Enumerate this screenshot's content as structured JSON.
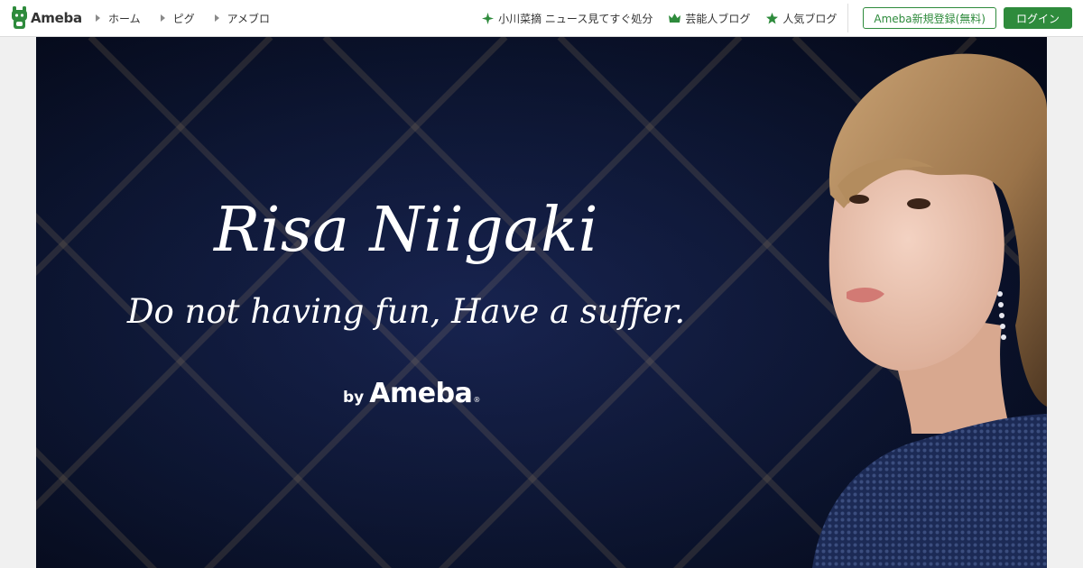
{
  "header": {
    "logo_text": "Ameba",
    "nav_left": [
      {
        "label": "ホーム"
      },
      {
        "label": "ピグ"
      },
      {
        "label": "アメブロ"
      }
    ],
    "nav_right": [
      {
        "label": "小川菜摘 ニュース見てすぐ処分",
        "icon": "sparkle-icon"
      },
      {
        "label": "芸能人ブログ",
        "icon": "crown-icon"
      },
      {
        "label": "人気ブログ",
        "icon": "star-icon"
      }
    ],
    "register_label": "Ameba新規登録(無料)",
    "login_label": "ログイン"
  },
  "banner": {
    "title": "Risa Niigaki",
    "tagline": "Do not having fun, Have a suffer.",
    "by_text": "by",
    "by_brand": "Ameba",
    "by_reg": "®"
  },
  "colors": {
    "brand_green": "#2e8b3c",
    "banner_navy": "#0d1737",
    "header_bg": "#ffffff",
    "page_bg": "#f0f0f0"
  }
}
